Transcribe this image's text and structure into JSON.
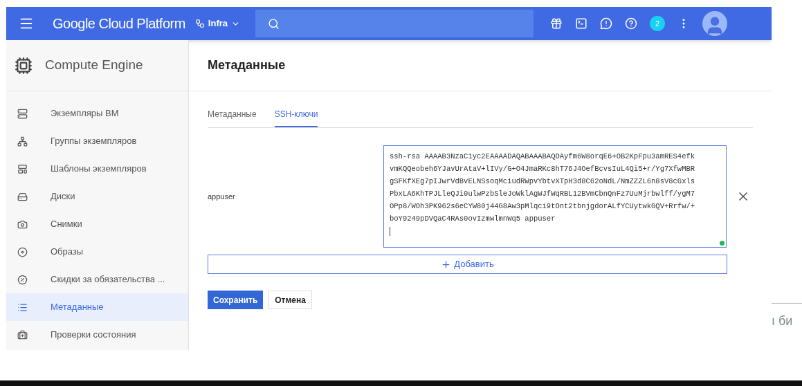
{
  "topbar": {
    "brand": "Google Cloud Platform",
    "project": "Infra",
    "notification_count": "2"
  },
  "sidebar": {
    "title": "Compute Engine",
    "items": [
      {
        "label": "Экземпляры ВМ",
        "selected": false
      },
      {
        "label": "Группы экземпляров",
        "selected": false
      },
      {
        "label": "Шаблоны экземпляров",
        "selected": false
      },
      {
        "label": "Диски",
        "selected": false
      },
      {
        "label": "Снимки",
        "selected": false
      },
      {
        "label": "Образы",
        "selected": false
      },
      {
        "label": "Скидки за обязательства ...",
        "selected": false
      },
      {
        "label": "Метаданные",
        "selected": true
      },
      {
        "label": "Проверки состояния",
        "selected": false
      }
    ]
  },
  "page": {
    "title": "Метаданные",
    "tabs": [
      {
        "label": "Метаданные",
        "selected": false
      },
      {
        "label": "SSH-ключи",
        "selected": true
      }
    ],
    "ssh_keys": [
      {
        "username": "appuser",
        "key_lines": [
          "ssh-rsa AAAAB3NzaC1yc2EAAAADAQABAAABAQDAyfm6W8orqE6+OB2KpFpu3amRES4efk",
          "vmKQQeobeh6YJavUrAtaV+lIVy/G+O4JmaRKc8hT76J4OefBcvsIuL4Qi5+r/Yg7XfwMBR",
          "gSFKfXEg7pIJwrVdBvELNSsoqMciudRWpvYbtvXTpH3d8C62oNdL/NmZZZL6n8sV8cGxls",
          "PbxLA6KhTPJLleQJi0ulwPzbSleJoWklAgWJfWqRBL12BVmCbnQnFz7UuMjrbwlff/ygM7",
          "OPp8/WOh3PK962s6eCYW80j44G8Aw3pMlqci9tOnt2tbnjgdorALfYCUytwkGQV+Rrfw/+",
          "boY9249pDVQaC4RAs0ovIzmwlmnWq5 appuser"
        ]
      }
    ],
    "add_button": "Добавить",
    "save_button": "Сохранить",
    "cancel_button": "Отмена"
  },
  "background_fragment": "ı би"
}
